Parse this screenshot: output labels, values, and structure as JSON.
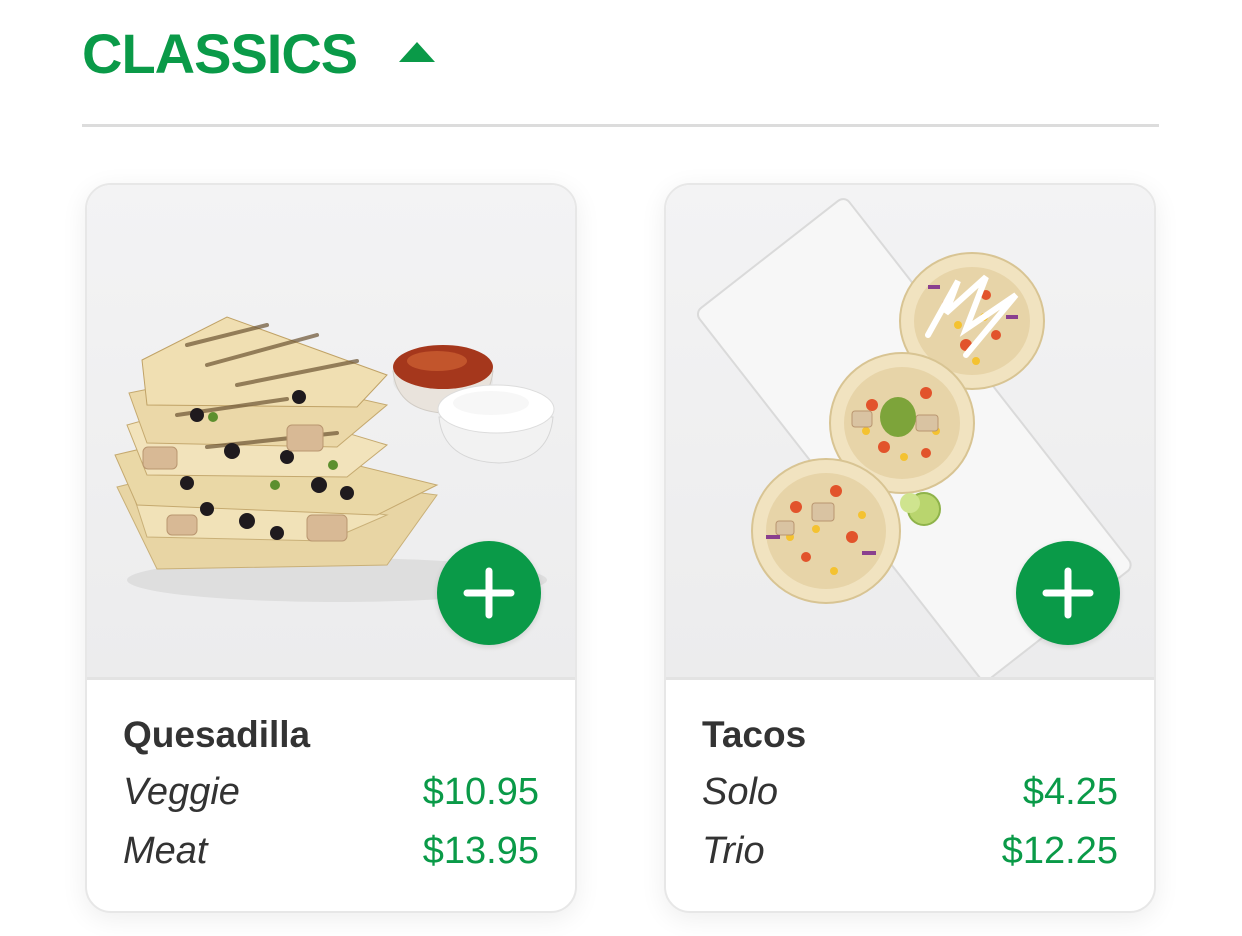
{
  "section": {
    "title": "CLASSICS"
  },
  "colors": {
    "accent": "#0a9a48",
    "text": "#333333",
    "divider": "#dcdcdc"
  },
  "items": [
    {
      "name": "Quesadilla",
      "image_icon": "quesadilla-photo",
      "options": [
        {
          "label": "Veggie",
          "price": "$10.95"
        },
        {
          "label": "Meat",
          "price": "$13.95"
        }
      ]
    },
    {
      "name": "Tacos",
      "image_icon": "tacos-photo",
      "options": [
        {
          "label": "Solo",
          "price": "$4.25"
        },
        {
          "label": "Trio",
          "price": "$12.25"
        }
      ]
    }
  ]
}
